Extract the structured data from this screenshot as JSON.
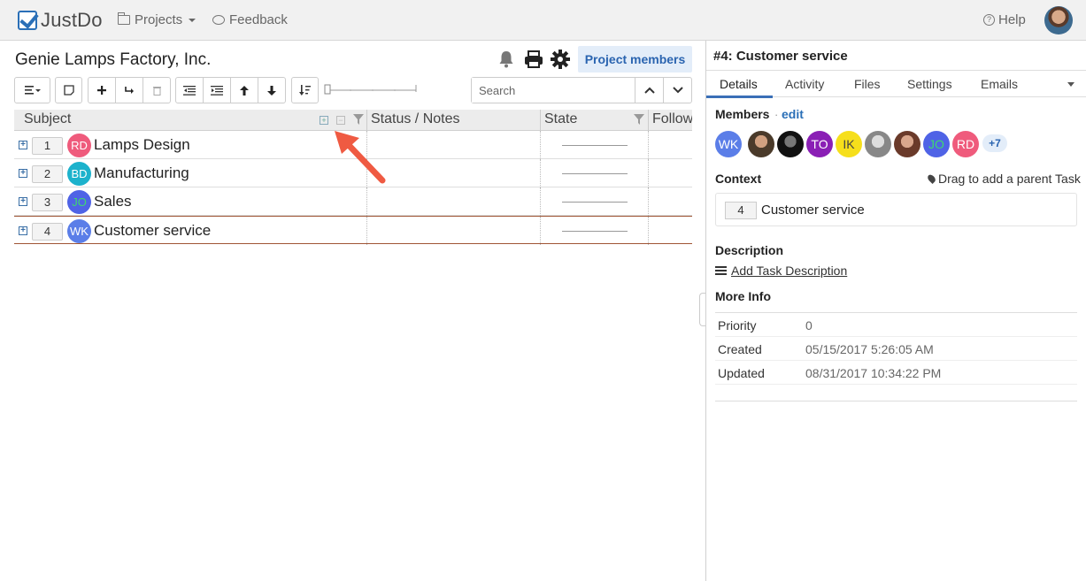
{
  "app": {
    "logo_text": "JustDo",
    "brand_color": "#2a6fb7"
  },
  "nav": {
    "projects_label": "Projects",
    "feedback_label": "Feedback",
    "help_label": "Help"
  },
  "project": {
    "title": "Genie Lamps Factory, Inc.",
    "members_button": "Project members"
  },
  "search": {
    "placeholder": "Search"
  },
  "grid": {
    "columns": [
      "Subject",
      "Status / Notes",
      "State",
      "Follow"
    ],
    "rows": [
      {
        "num": "1",
        "initials": "RD",
        "avatar_color": "#ef5b7c",
        "subject": "Lamps Design"
      },
      {
        "num": "2",
        "initials": "BD",
        "avatar_color": "#1cb2cc",
        "subject": "Manufacturing"
      },
      {
        "num": "3",
        "initials": "JO",
        "avatar_color": "#4f63e6",
        "subject": "Sales"
      },
      {
        "num": "4",
        "initials": "WK",
        "avatar_color": "#5b7ee8",
        "subject": "Customer service"
      }
    ]
  },
  "detail": {
    "title": "#4: Customer service",
    "tabs": [
      "Details",
      "Activity",
      "Files",
      "Settings",
      "Emails"
    ],
    "members_label": "Members",
    "edit_label": "edit",
    "members": [
      {
        "initials": "WK",
        "color": "#5b7ee8"
      },
      {
        "initials": "",
        "color": "#6b5a4a"
      },
      {
        "initials": "",
        "color": "#222222"
      },
      {
        "initials": "TO",
        "color": "#8a1fb5"
      },
      {
        "initials": "IK",
        "color": "#f6df1b"
      },
      {
        "initials": "",
        "color": "#9a9a9a"
      },
      {
        "initials": "",
        "color": "#8a5a4a"
      },
      {
        "initials": "JO",
        "color": "#4f63e6"
      },
      {
        "initials": "RD",
        "color": "#ef5b7c"
      }
    ],
    "more_members": "+7",
    "context_label": "Context",
    "drag_parent": "Drag to add a parent Task",
    "context": {
      "num": "4",
      "subject": "Customer service"
    },
    "description_label": "Description",
    "add_description": "Add Task Description",
    "more_info_label": "More Info",
    "info": [
      {
        "key": "Priority",
        "value": "0"
      },
      {
        "key": "Created",
        "value": "05/15/2017 5:26:05 AM"
      },
      {
        "key": "Updated",
        "value": "08/31/2017 10:34:22 PM"
      }
    ]
  }
}
